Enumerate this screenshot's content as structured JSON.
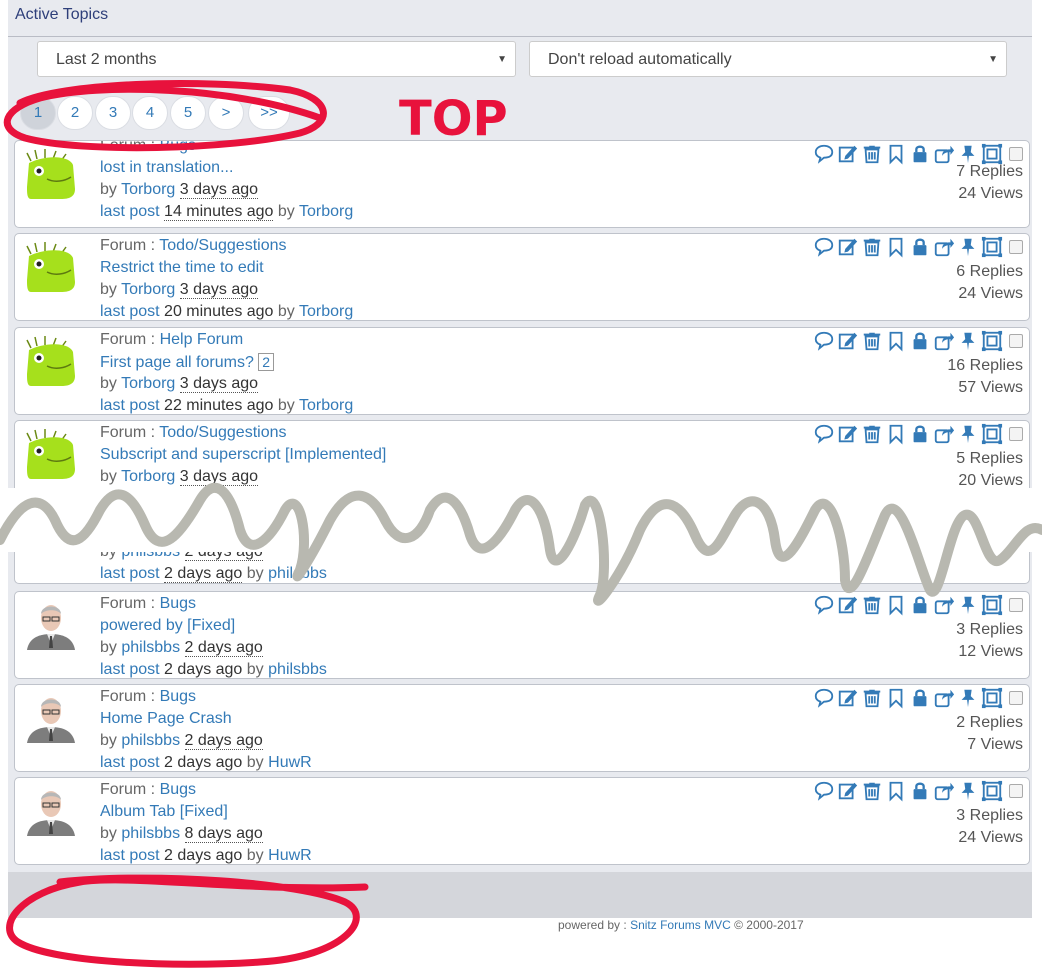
{
  "header": {
    "title": "Active Topics"
  },
  "filters": {
    "period": "Last 2 months",
    "reload": "Don't reload automatically"
  },
  "pagination": [
    "1",
    "2",
    "3",
    "4",
    "5",
    ">",
    ">>"
  ],
  "annotation": {
    "top_label": "TOP"
  },
  "labels": {
    "forum_prefix": "Forum :",
    "by": "by",
    "last_post": "last post",
    "by_after": "by"
  },
  "topics": [
    {
      "forum": "Bugs",
      "title": "lost in translation...",
      "author": "Torborg",
      "created": "3 days ago",
      "last_post": "14 minutes ago",
      "last_by": "Torborg",
      "replies": "7 Replies",
      "views": "24 Views"
    },
    {
      "forum": "Todo/Suggestions",
      "title": "Restrict the time to edit",
      "author": "Torborg",
      "created": "3 days ago",
      "last_post": "20 minutes ago",
      "last_by": "Torborg",
      "replies": "6 Replies",
      "views": "24 Views"
    },
    {
      "forum": "Help Forum",
      "title": "First page all forums?",
      "page_link": "2",
      "author": "Torborg",
      "created": "3 days ago",
      "last_post": "22 minutes ago",
      "last_by": "Torborg",
      "replies": "16 Replies",
      "views": "57 Views"
    },
    {
      "forum": "Todo/Suggestions",
      "title": "Subscript and superscript [Implemented]",
      "author": "Torborg",
      "created": "3 days ago",
      "replies": "5 Replies",
      "views": "20 Views"
    },
    {
      "author": "philsbbs",
      "created": "2 days ago",
      "last_post": "2 days ago",
      "last_by": "philsbbs"
    },
    {
      "forum": "Bugs",
      "title": "powered by [Fixed]",
      "author": "philsbbs",
      "created": "2 days ago",
      "last_post": "2 days ago",
      "last_by": "philsbbs",
      "replies": "3 Replies",
      "views": "12 Views"
    },
    {
      "forum": "Bugs",
      "title": "Home Page Crash",
      "author": "philsbbs",
      "created": "2 days ago",
      "last_post": "2 days ago",
      "last_by": "HuwR",
      "replies": "2 Replies",
      "views": "7 Views"
    },
    {
      "forum": "Bugs",
      "title": "Album Tab [Fixed]",
      "author": "philsbbs",
      "created": "8 days ago",
      "last_post": "2 days ago",
      "last_by": "HuwR",
      "replies": "3 Replies",
      "views": "24 Views"
    }
  ],
  "footer": {
    "powered_by": "powered by :",
    "product": "Snitz Forums MVC",
    "copyright": "© 2000-2017"
  },
  "colors": {
    "link": "#337ab7",
    "annotation": "#e8123c",
    "scribble": "#b8b8b0"
  }
}
